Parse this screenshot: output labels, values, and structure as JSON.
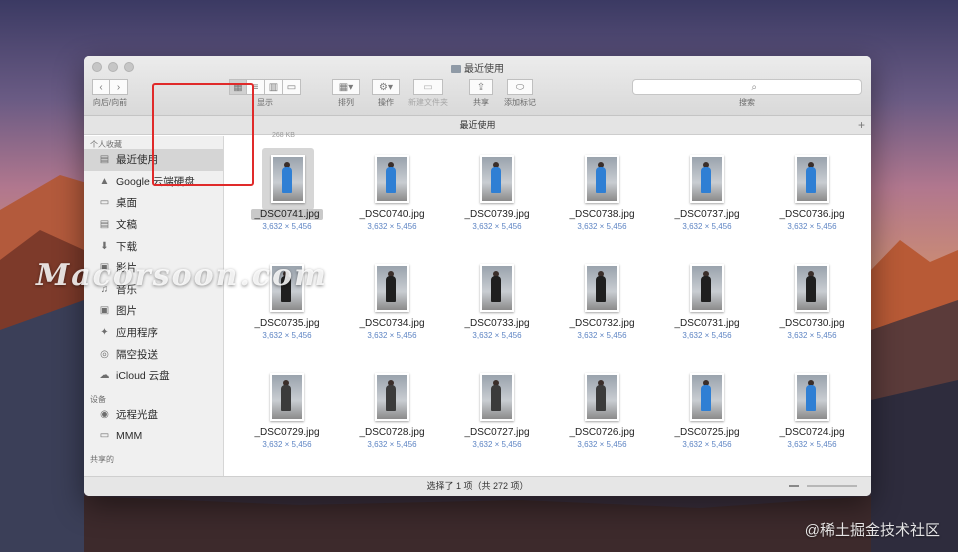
{
  "window": {
    "title": "最近使用",
    "path_title": "最近使用",
    "status": "选择了 1 项（共 272 项）",
    "size_hint": "268 KB"
  },
  "toolbar": {
    "nav_label": "向后/向前",
    "view_label": "显示",
    "arrange_label": "排列",
    "action_label": "操作",
    "newfolder_label": "新建文件夹",
    "share_label": "共享",
    "tags_label": "添加标记",
    "search_label": "搜索",
    "search_placeholder": ""
  },
  "sidebar": {
    "sections": {
      "favorites": "个人收藏",
      "devices": "设备",
      "shared": "共享的"
    },
    "favorites": [
      {
        "label": "最近使用",
        "icon": "recents-icon",
        "selected": true
      },
      {
        "label": "Google 云端硬盘",
        "icon": "google-drive-icon"
      },
      {
        "label": "桌面",
        "icon": "desktop-icon"
      },
      {
        "label": "文稿",
        "icon": "documents-icon"
      },
      {
        "label": "下载",
        "icon": "downloads-icon"
      },
      {
        "label": "影片",
        "icon": "movies-icon"
      },
      {
        "label": "音乐",
        "icon": "music-icon"
      },
      {
        "label": "图片",
        "icon": "pictures-icon"
      },
      {
        "label": "应用程序",
        "icon": "applications-icon"
      },
      {
        "label": "隔空投送",
        "icon": "airdrop-icon"
      },
      {
        "label": "iCloud 云盘",
        "icon": "icloud-icon"
      }
    ],
    "devices": [
      {
        "label": "远程光盘",
        "icon": "remote-disc-icon"
      },
      {
        "label": "MMM",
        "icon": "disk-icon"
      }
    ]
  },
  "files": [
    {
      "name": "_DSC0741.jpg",
      "dims": "3,632 × 5,456",
      "selected": true,
      "shirt": "#2f7fd4"
    },
    {
      "name": "_DSC0740.jpg",
      "dims": "3,632 × 5,456",
      "shirt": "#2f7fd4"
    },
    {
      "name": "_DSC0739.jpg",
      "dims": "3,632 × 5,456",
      "shirt": "#2f7fd4"
    },
    {
      "name": "_DSC0738.jpg",
      "dims": "3,632 × 5,456",
      "shirt": "#2f7fd4"
    },
    {
      "name": "_DSC0737.jpg",
      "dims": "3,632 × 5,456",
      "shirt": "#2f7fd4"
    },
    {
      "name": "_DSC0736.jpg",
      "dims": "3,632 × 5,456",
      "shirt": "#2f7fd4"
    },
    {
      "name": "_DSC0735.jpg",
      "dims": "3,632 × 5,456",
      "shirt": "#1f1f1f"
    },
    {
      "name": "_DSC0734.jpg",
      "dims": "3,632 × 5,456",
      "shirt": "#1f1f1f"
    },
    {
      "name": "_DSC0733.jpg",
      "dims": "3,632 × 5,456",
      "shirt": "#1f1f1f"
    },
    {
      "name": "_DSC0732.jpg",
      "dims": "3,632 × 5,456",
      "shirt": "#1f1f1f"
    },
    {
      "name": "_DSC0731.jpg",
      "dims": "3,632 × 5,456",
      "shirt": "#1f1f1f"
    },
    {
      "name": "_DSC0730.jpg",
      "dims": "3,632 × 5,456",
      "shirt": "#1f1f1f"
    },
    {
      "name": "_DSC0729.jpg",
      "dims": "3,632 × 5,456",
      "shirt": "#3b3b3b"
    },
    {
      "name": "_DSC0728.jpg",
      "dims": "3,632 × 5,456",
      "shirt": "#3b3b3b"
    },
    {
      "name": "_DSC0727.jpg",
      "dims": "3,632 × 5,456",
      "shirt": "#3b3b3b"
    },
    {
      "name": "_DSC0726.jpg",
      "dims": "3,632 × 5,456",
      "shirt": "#3b3b3b"
    },
    {
      "name": "_DSC0725.jpg",
      "dims": "3,632 × 5,456",
      "shirt": "#2f7fd4"
    },
    {
      "name": "_DSC0724.jpg",
      "dims": "3,632 × 5,456",
      "shirt": "#2f7fd4"
    }
  ],
  "overlay": {
    "watermark": "Macorsoon.com",
    "credit": "@稀土掘金技术社区",
    "highlight_color": "#e02a2a"
  }
}
